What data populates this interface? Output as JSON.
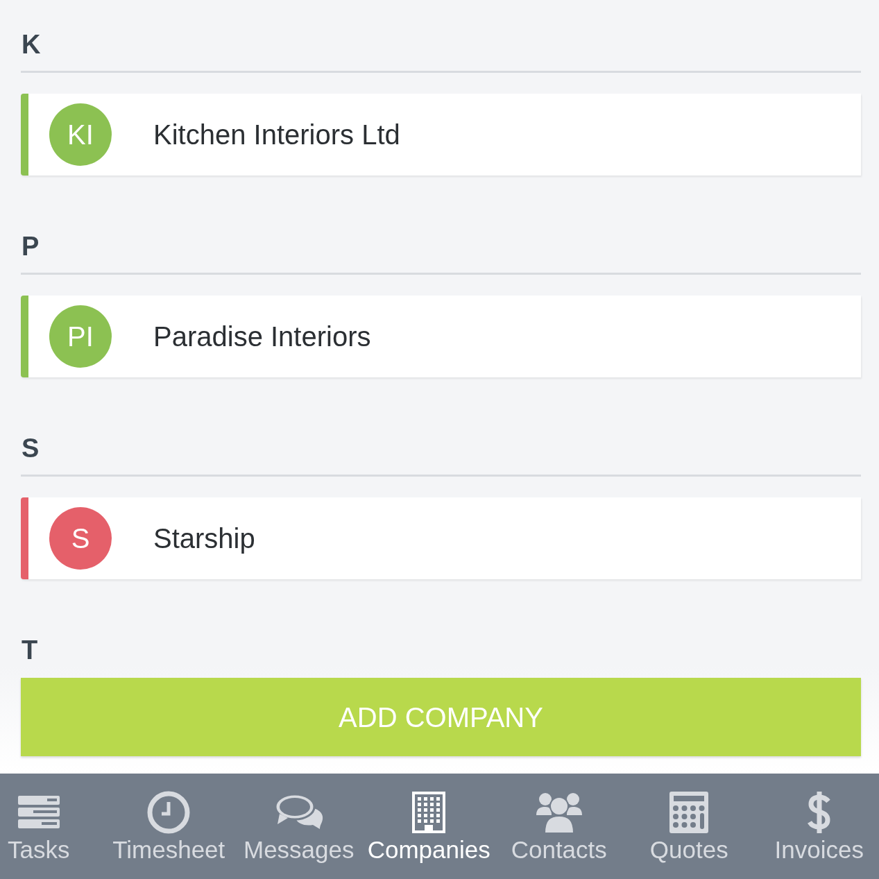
{
  "sections": [
    {
      "letter": "K",
      "items": [
        {
          "initials": "KI",
          "name": "Kitchen Interiors Ltd",
          "color": "#8cc152"
        }
      ]
    },
    {
      "letter": "P",
      "items": [
        {
          "initials": "PI",
          "name": "Paradise Interiors",
          "color": "#8cc152"
        }
      ]
    },
    {
      "letter": "S",
      "items": [
        {
          "initials": "S",
          "name": "Starship",
          "color": "#e5606a"
        }
      ]
    },
    {
      "letter": "T"
    }
  ],
  "add_button": "ADD COMPANY",
  "tabs": [
    {
      "label": "Tasks",
      "selected": false
    },
    {
      "label": "Timesheet",
      "selected": false
    },
    {
      "label": "Messages",
      "selected": false
    },
    {
      "label": "Companies",
      "selected": true
    },
    {
      "label": "Contacts",
      "selected": false
    },
    {
      "label": "Quotes",
      "selected": false
    },
    {
      "label": "Invoices",
      "selected": false
    }
  ]
}
